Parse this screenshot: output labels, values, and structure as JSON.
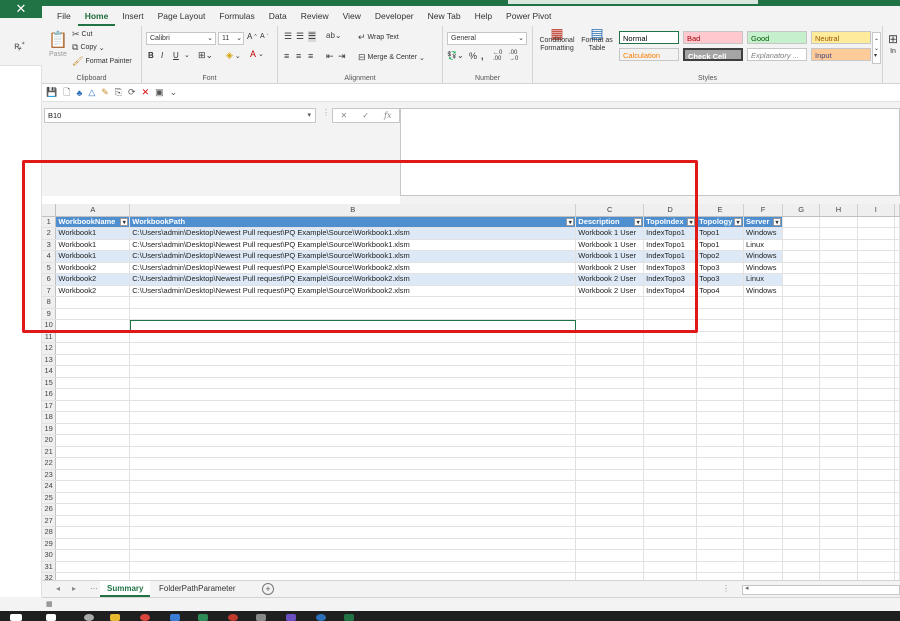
{
  "menu": {
    "tabs": [
      "File",
      "Home",
      "Insert",
      "Page Layout",
      "Formulas",
      "Data",
      "Review",
      "View",
      "Developer",
      "New Tab",
      "Help",
      "Power Pivot"
    ],
    "active": "Home"
  },
  "ribbon": {
    "clipboard": {
      "paste": "Paste",
      "cut": "Cut",
      "copy": "Copy",
      "format_painter": "Format Painter",
      "label": "Clipboard"
    },
    "font": {
      "name": "Calibri",
      "size": "11",
      "label": "Font"
    },
    "alignment": {
      "wrap_text": "Wrap Text",
      "merge_center": "Merge & Center",
      "label": "Alignment"
    },
    "number": {
      "format": "General",
      "label": "Number"
    },
    "styles": {
      "conditional_formatting": "Conditional Formatting",
      "format_as_table": "Format as Table",
      "cells": [
        {
          "name": "Normal",
          "bg": "#ffffff",
          "fg": "#000000"
        },
        {
          "name": "Bad",
          "bg": "#ffc7ce",
          "fg": "#9c0006"
        },
        {
          "name": "Good",
          "bg": "#c6efce",
          "fg": "#006100"
        },
        {
          "name": "Neutral",
          "bg": "#ffeb9c",
          "fg": "#9c5700"
        },
        {
          "name": "Calculation",
          "bg": "#f2f2f2",
          "fg": "#fa7d00"
        },
        {
          "name": "Check Cell",
          "bg": "#a5a5a5",
          "fg": "#ffffff"
        },
        {
          "name": "Explanatory ...",
          "bg": "#ffffff",
          "fg": "#7f7f7f"
        },
        {
          "name": "Input",
          "bg": "#ffcc99",
          "fg": "#3f3f76"
        }
      ],
      "label": "Styles"
    },
    "insert_partial": "In"
  },
  "formula_bar": {
    "name_box": "B10",
    "cancel": "✕",
    "confirm": "✓",
    "fx": "fx",
    "value": ""
  },
  "sheet": {
    "columns": [
      "A",
      "B",
      "C",
      "D",
      "E",
      "F",
      "G",
      "H",
      "I"
    ],
    "header": [
      "WorkbookName",
      "WorkbookPath",
      "Description",
      "TopoIndex",
      "Topology",
      "Server"
    ],
    "rows": [
      [
        "Workbook1",
        "C:\\Users\\admin\\Desktop\\Newest Pull request\\PQ Example\\Source\\Workbook1.xlsm",
        "Workbook 1 User",
        "IndexTopo1",
        "Topo1",
        "Windows"
      ],
      [
        "Workbook1",
        "C:\\Users\\admin\\Desktop\\Newest Pull request\\PQ Example\\Source\\Workbook1.xlsm",
        "Workbook 1 User",
        "IndexTopo1",
        "Topo1",
        "Linux"
      ],
      [
        "Workbook1",
        "C:\\Users\\admin\\Desktop\\Newest Pull request\\PQ Example\\Source\\Workbook1.xlsm",
        "Workbook 1 User",
        "IndexTopo1",
        "Topo2",
        "Windows"
      ],
      [
        "Workbook2",
        "C:\\Users\\admin\\Desktop\\Newest Pull request\\PQ Example\\Source\\Workbook2.xlsm",
        "Workbook 2 User",
        "IndexTopo3",
        "Topo3",
        "Windows"
      ],
      [
        "Workbook2",
        "C:\\Users\\admin\\Desktop\\Newest Pull request\\PQ Example\\Source\\Workbook2.xlsm",
        "Workbook 2 User",
        "IndexTopo3",
        "Topo3",
        "Linux"
      ],
      [
        "Workbook2",
        "C:\\Users\\admin\\Desktop\\Newest Pull request\\PQ Example\\Source\\Workbook2.xlsm",
        "Workbook 2 User",
        "IndexTopo4",
        "Topo4",
        "Windows"
      ]
    ],
    "row_numbers": [
      "1",
      "2",
      "3",
      "4",
      "5",
      "6",
      "7",
      "8",
      "9",
      "10",
      "11",
      "12",
      "13",
      "14",
      "15",
      "16",
      "17",
      "18",
      "19",
      "20",
      "21",
      "22",
      "23",
      "24",
      "25",
      "26",
      "27",
      "28",
      "29",
      "30",
      "31",
      "32"
    ],
    "selected_cell": "B10",
    "table_header_color": "#4f8fcf",
    "band_color": "#dde9f6"
  },
  "sheet_tabs": {
    "tabs": [
      "Summary",
      "FolderPathParameter"
    ],
    "active": "Summary"
  },
  "annotation_color": "#e01818"
}
